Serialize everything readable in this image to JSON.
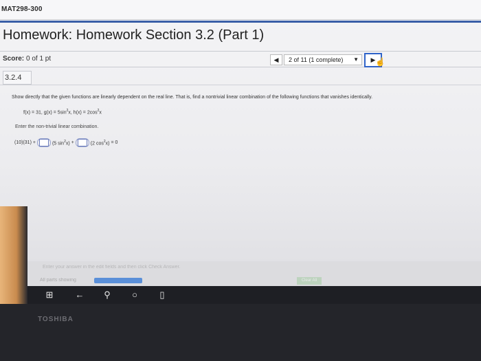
{
  "course": {
    "title": "MAT298-300"
  },
  "homework": {
    "title": "Homework: Homework Section 3.2 (Part 1)"
  },
  "score": {
    "label": "Score:",
    "value": "0 of 1 pt"
  },
  "nav": {
    "prev": "◀",
    "status": "2 of 11 (1 complete)",
    "dropdown": "▼",
    "next": "▶"
  },
  "question": {
    "number": "3.2.4",
    "instruction": "Show directly that the given functions are linearly dependent on the real line. That is, find a nontrivial linear combination of the following functions that vanishes identically.",
    "functions": {
      "f": "f(x) = 31, g(x) = 5sin",
      "sup1": "2",
      "mid": "x, h(x) = 2cos",
      "sup2": "2",
      "end": "x"
    },
    "enter_prompt": "Enter the non-trivial linear combination.",
    "combo": {
      "lead": "(10)(31) +",
      "term1a": "(5 sin",
      "term1sup": "2",
      "term1b": "x)",
      "plus": "+",
      "term2a": "(2 cos",
      "term2sup": "2",
      "term2b": "x)",
      "equals": "= 0"
    }
  },
  "footer": {
    "hint": "Enter your answer in the edit fields and then click Check Answer.",
    "parts_label": "All parts showing",
    "progress": 1.0,
    "check_button": "Clear All"
  },
  "taskbar": {
    "icons": [
      "windows-icon",
      "back-icon",
      "search-icon",
      "cortana-icon",
      "task-view-icon"
    ]
  },
  "laptop": {
    "brand": "TOSHIBA"
  }
}
